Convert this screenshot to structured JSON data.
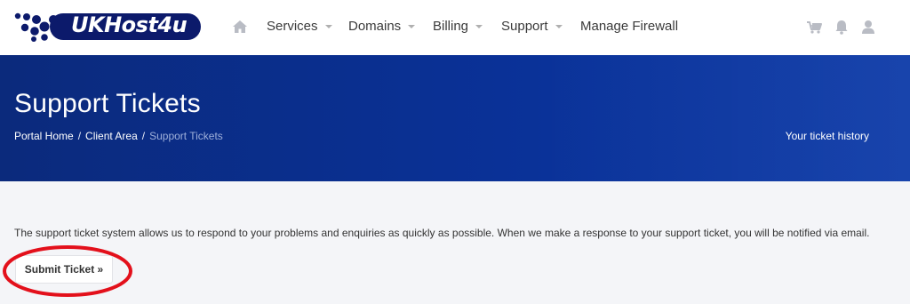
{
  "brand": {
    "name": "UKHost4u",
    "logo_color": "#0c1a6b"
  },
  "nav": {
    "home_icon": "home-icon",
    "items": [
      {
        "label": "Services",
        "has_caret": true
      },
      {
        "label": "Domains",
        "has_caret": true
      },
      {
        "label": "Billing",
        "has_caret": true
      },
      {
        "label": "Support",
        "has_caret": true
      },
      {
        "label": "Manage Firewall",
        "has_caret": false
      }
    ],
    "right_icons": [
      "cart-icon",
      "bell-icon",
      "user-icon"
    ]
  },
  "header": {
    "title": "Support Tickets",
    "breadcrumbs": [
      {
        "label": "Portal Home"
      },
      {
        "label": "Client Area"
      },
      {
        "label": "Support Tickets"
      }
    ],
    "side_link": "Your ticket history",
    "background_color": "#0a3197"
  },
  "main": {
    "intro_text": "The support ticket system allows us to respond to your problems and enquiries as quickly as possible. When we make a response to your support ticket, you will be notified via email.",
    "submit_button_label": "Submit Ticket »",
    "annotation_color": "#e3101b"
  }
}
